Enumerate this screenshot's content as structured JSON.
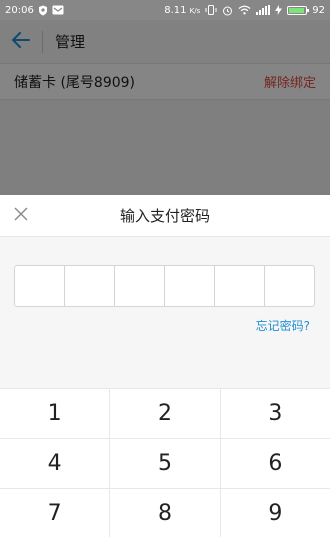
{
  "status_bar": {
    "time": "20:06",
    "speed": "8.11",
    "speed_unit": "K/s",
    "battery_level": "92",
    "battery_fraction": 0.92
  },
  "background_page": {
    "title": "管理",
    "card_label": "储蓄卡 (尾号8909)",
    "unbind_label": "解除绑定"
  },
  "password_sheet": {
    "title": "输入支付密码",
    "digit_count": 6,
    "forgot_label": "忘记密码?",
    "keys": [
      "1",
      "2",
      "3",
      "4",
      "5",
      "6",
      "7",
      "8",
      "9"
    ]
  },
  "colors": {
    "accent_link": "#1f8fd0",
    "danger": "#e0483f",
    "back_arrow": "#1f8fd0",
    "battery": "#7ee37a"
  },
  "icons": {
    "back": "arrow-left-icon",
    "close": "close-icon",
    "signal": "signal-icon",
    "wifi": "wifi-icon",
    "vibrate": "vibrate-icon",
    "alarm": "alarm-icon",
    "battery": "battery-icon",
    "charging": "charging-icon"
  }
}
